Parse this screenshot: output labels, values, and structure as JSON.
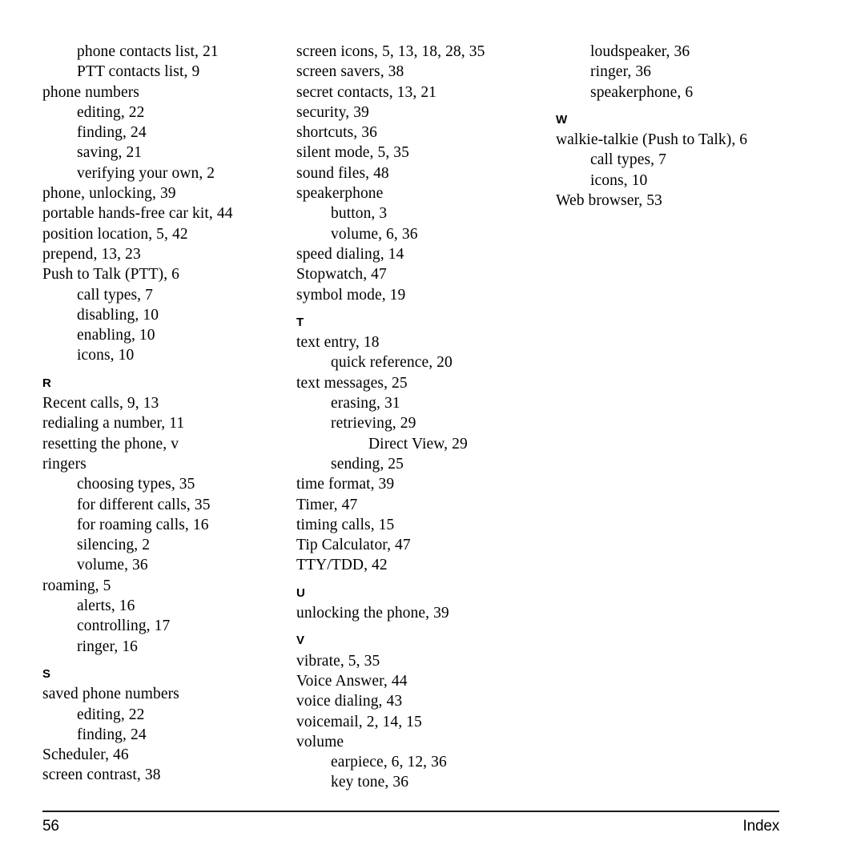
{
  "document": {
    "type": "book-index-page",
    "page_number": "56",
    "running_footer": "Index",
    "text_color": "#000000",
    "background_color": "#ffffff"
  },
  "columns": [
    {
      "id": "column-1",
      "blocks": [
        {
          "kind": "entry",
          "level": 1,
          "text": "phone contacts list, 21"
        },
        {
          "kind": "entry",
          "level": 1,
          "text": "PTT contacts list, 9"
        },
        {
          "kind": "entry",
          "level": 0,
          "text": "phone numbers"
        },
        {
          "kind": "entry",
          "level": 1,
          "text": "editing, 22"
        },
        {
          "kind": "entry",
          "level": 1,
          "text": "finding, 24"
        },
        {
          "kind": "entry",
          "level": 1,
          "text": "saving, 21"
        },
        {
          "kind": "entry",
          "level": 1,
          "text": "verifying your own, 2"
        },
        {
          "kind": "entry",
          "level": 0,
          "text": "phone, unlocking, 39"
        },
        {
          "kind": "entry",
          "level": 0,
          "text": "portable hands-free car kit, 44"
        },
        {
          "kind": "entry",
          "level": 0,
          "text": "position location, 5, 42"
        },
        {
          "kind": "entry",
          "level": 0,
          "text": "prepend, 13, 23"
        },
        {
          "kind": "entry",
          "level": 0,
          "text": "Push to Talk (PTT), 6"
        },
        {
          "kind": "entry",
          "level": 1,
          "text": "call types, 7"
        },
        {
          "kind": "entry",
          "level": 1,
          "text": "disabling, 10"
        },
        {
          "kind": "entry",
          "level": 1,
          "text": "enabling, 10"
        },
        {
          "kind": "entry",
          "level": 1,
          "text": "icons, 10"
        },
        {
          "kind": "heading",
          "text": "R"
        },
        {
          "kind": "entry",
          "level": 0,
          "text": "Recent calls, 9, 13"
        },
        {
          "kind": "entry",
          "level": 0,
          "text": "redialing a number, 11"
        },
        {
          "kind": "entry",
          "level": 0,
          "text": "resetting the phone, v"
        },
        {
          "kind": "entry",
          "level": 0,
          "text": "ringers"
        },
        {
          "kind": "entry",
          "level": 1,
          "text": "choosing types, 35"
        },
        {
          "kind": "entry",
          "level": 1,
          "text": "for different calls, 35"
        },
        {
          "kind": "entry",
          "level": 1,
          "text": "for roaming calls, 16"
        },
        {
          "kind": "entry",
          "level": 1,
          "text": "silencing, 2"
        },
        {
          "kind": "entry",
          "level": 1,
          "text": "volume, 36"
        },
        {
          "kind": "entry",
          "level": 0,
          "text": "roaming, 5"
        },
        {
          "kind": "entry",
          "level": 1,
          "text": "alerts, 16"
        },
        {
          "kind": "entry",
          "level": 1,
          "text": "controlling, 17"
        },
        {
          "kind": "entry",
          "level": 1,
          "text": "ringer, 16"
        },
        {
          "kind": "heading",
          "text": "S"
        },
        {
          "kind": "entry",
          "level": 0,
          "text": "saved phone numbers"
        },
        {
          "kind": "entry",
          "level": 1,
          "text": "editing, 22"
        },
        {
          "kind": "entry",
          "level": 1,
          "text": "finding, 24"
        },
        {
          "kind": "entry",
          "level": 0,
          "text": "Scheduler, 46"
        },
        {
          "kind": "entry",
          "level": 0,
          "text": "screen contrast, 38"
        }
      ]
    },
    {
      "id": "column-2",
      "blocks": [
        {
          "kind": "entry",
          "level": 0,
          "text": "screen icons, 5, 13, 18, 28, 35"
        },
        {
          "kind": "entry",
          "level": 0,
          "text": "screen savers, 38"
        },
        {
          "kind": "entry",
          "level": 0,
          "text": "secret contacts, 13, 21"
        },
        {
          "kind": "entry",
          "level": 0,
          "text": "security, 39"
        },
        {
          "kind": "entry",
          "level": 0,
          "text": "shortcuts, 36"
        },
        {
          "kind": "entry",
          "level": 0,
          "text": "silent mode, 5, 35"
        },
        {
          "kind": "entry",
          "level": 0,
          "text": "sound files, 48"
        },
        {
          "kind": "entry",
          "level": 0,
          "text": "speakerphone"
        },
        {
          "kind": "entry",
          "level": 1,
          "text": "button, 3"
        },
        {
          "kind": "entry",
          "level": 1,
          "text": "volume, 6, 36"
        },
        {
          "kind": "entry",
          "level": 0,
          "text": "speed dialing, 14"
        },
        {
          "kind": "entry",
          "level": 0,
          "text": "Stopwatch, 47"
        },
        {
          "kind": "entry",
          "level": 0,
          "text": "symbol mode, 19"
        },
        {
          "kind": "heading",
          "text": "T"
        },
        {
          "kind": "entry",
          "level": 0,
          "text": "text entry, 18"
        },
        {
          "kind": "entry",
          "level": 1,
          "text": "quick reference, 20"
        },
        {
          "kind": "entry",
          "level": 0,
          "text": "text messages, 25"
        },
        {
          "kind": "entry",
          "level": 1,
          "text": "erasing, 31"
        },
        {
          "kind": "entry",
          "level": 1,
          "text": "retrieving, 29"
        },
        {
          "kind": "entry",
          "level": 2,
          "text": "Direct View, 29"
        },
        {
          "kind": "entry",
          "level": 1,
          "text": "sending, 25"
        },
        {
          "kind": "entry",
          "level": 0,
          "text": "time format, 39"
        },
        {
          "kind": "entry",
          "level": 0,
          "text": "Timer, 47"
        },
        {
          "kind": "entry",
          "level": 0,
          "text": "timing calls, 15"
        },
        {
          "kind": "entry",
          "level": 0,
          "text": "Tip Calculator, 47"
        },
        {
          "kind": "entry",
          "level": 0,
          "text": "TTY/TDD, 42"
        },
        {
          "kind": "heading",
          "text": "U"
        },
        {
          "kind": "entry",
          "level": 0,
          "text": "unlocking the phone, 39"
        },
        {
          "kind": "heading",
          "text": "V"
        },
        {
          "kind": "entry",
          "level": 0,
          "text": "vibrate, 5, 35"
        },
        {
          "kind": "entry",
          "level": 0,
          "text": "Voice Answer, 44"
        },
        {
          "kind": "entry",
          "level": 0,
          "text": "voice dialing, 43"
        },
        {
          "kind": "entry",
          "level": 0,
          "text": "voicemail, 2, 14, 15"
        },
        {
          "kind": "entry",
          "level": 0,
          "text": "volume"
        },
        {
          "kind": "entry",
          "level": 1,
          "text": "earpiece, 6, 12, 36"
        },
        {
          "kind": "entry",
          "level": 1,
          "text": "key tone, 36"
        }
      ]
    },
    {
      "id": "column-3",
      "blocks": [
        {
          "kind": "entry",
          "level": 1,
          "text": "loudspeaker, 36"
        },
        {
          "kind": "entry",
          "level": 1,
          "text": "ringer, 36"
        },
        {
          "kind": "entry",
          "level": 1,
          "text": "speakerphone, 6"
        },
        {
          "kind": "heading",
          "text": "W"
        },
        {
          "kind": "entry",
          "level": 0,
          "text": "walkie-talkie (Push to Talk), 6"
        },
        {
          "kind": "entry",
          "level": 1,
          "text": "call types, 7"
        },
        {
          "kind": "entry",
          "level": 1,
          "text": "icons, 10"
        },
        {
          "kind": "entry",
          "level": 0,
          "text": "Web browser, 53"
        }
      ]
    }
  ]
}
